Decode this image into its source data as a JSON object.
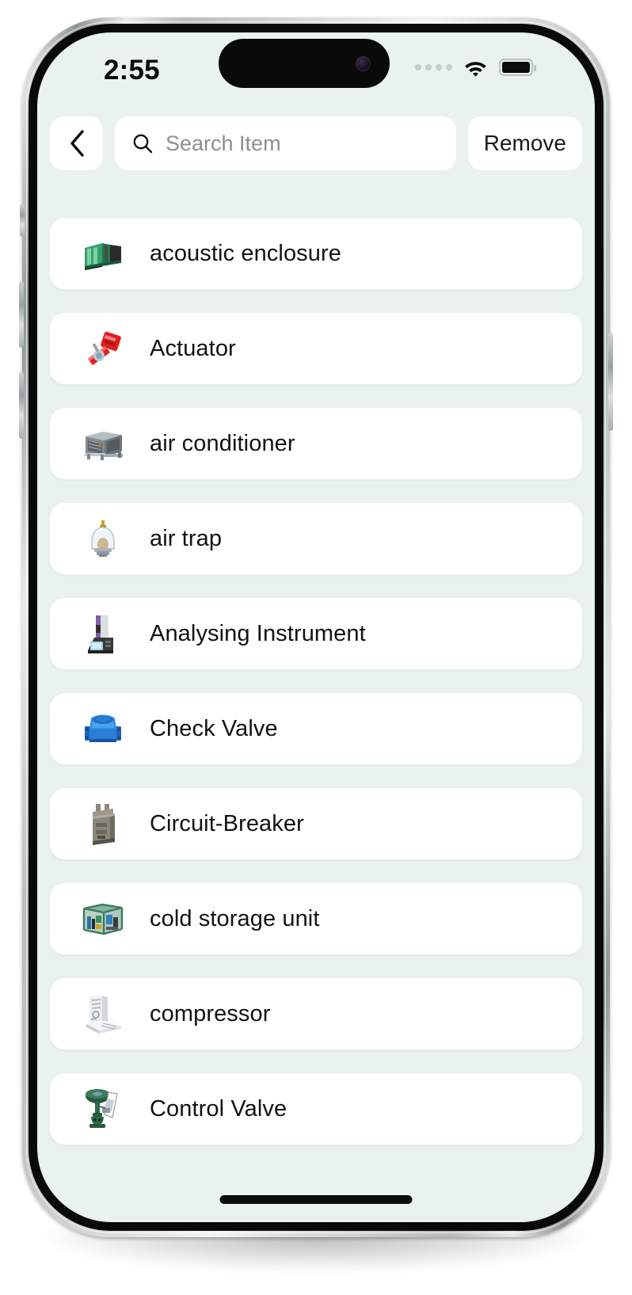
{
  "status_bar": {
    "time": "2:55",
    "signal_icon": "signal-dots-icon",
    "wifi_icon": "wifi-icon",
    "battery_icon": "battery-full-icon"
  },
  "topbar": {
    "back_icon": "chevron-left-icon",
    "search_icon": "search-icon",
    "search_value": "",
    "search_placeholder": "Search Item",
    "remove_label": "Remove"
  },
  "colors": {
    "screen_background": "#e9f2ee",
    "card_background": "#ffffff",
    "text_primary": "#121212",
    "placeholder": "#8e8e93"
  },
  "list": {
    "items": [
      {
        "label": "acoustic enclosure",
        "icon": "acoustic-enclosure-icon"
      },
      {
        "label": "Actuator",
        "icon": "actuator-icon"
      },
      {
        "label": "air conditioner",
        "icon": "air-conditioner-icon"
      },
      {
        "label": "air trap",
        "icon": "air-trap-icon"
      },
      {
        "label": "Analysing Instrument",
        "icon": "analysing-instrument-icon"
      },
      {
        "label": "Check Valve",
        "icon": "check-valve-icon"
      },
      {
        "label": "Circuit-Breaker",
        "icon": "circuit-breaker-icon"
      },
      {
        "label": "cold storage unit",
        "icon": "cold-storage-unit-icon"
      },
      {
        "label": "compressor",
        "icon": "compressor-icon"
      },
      {
        "label": "Control Valve",
        "icon": "control-valve-icon"
      }
    ]
  }
}
